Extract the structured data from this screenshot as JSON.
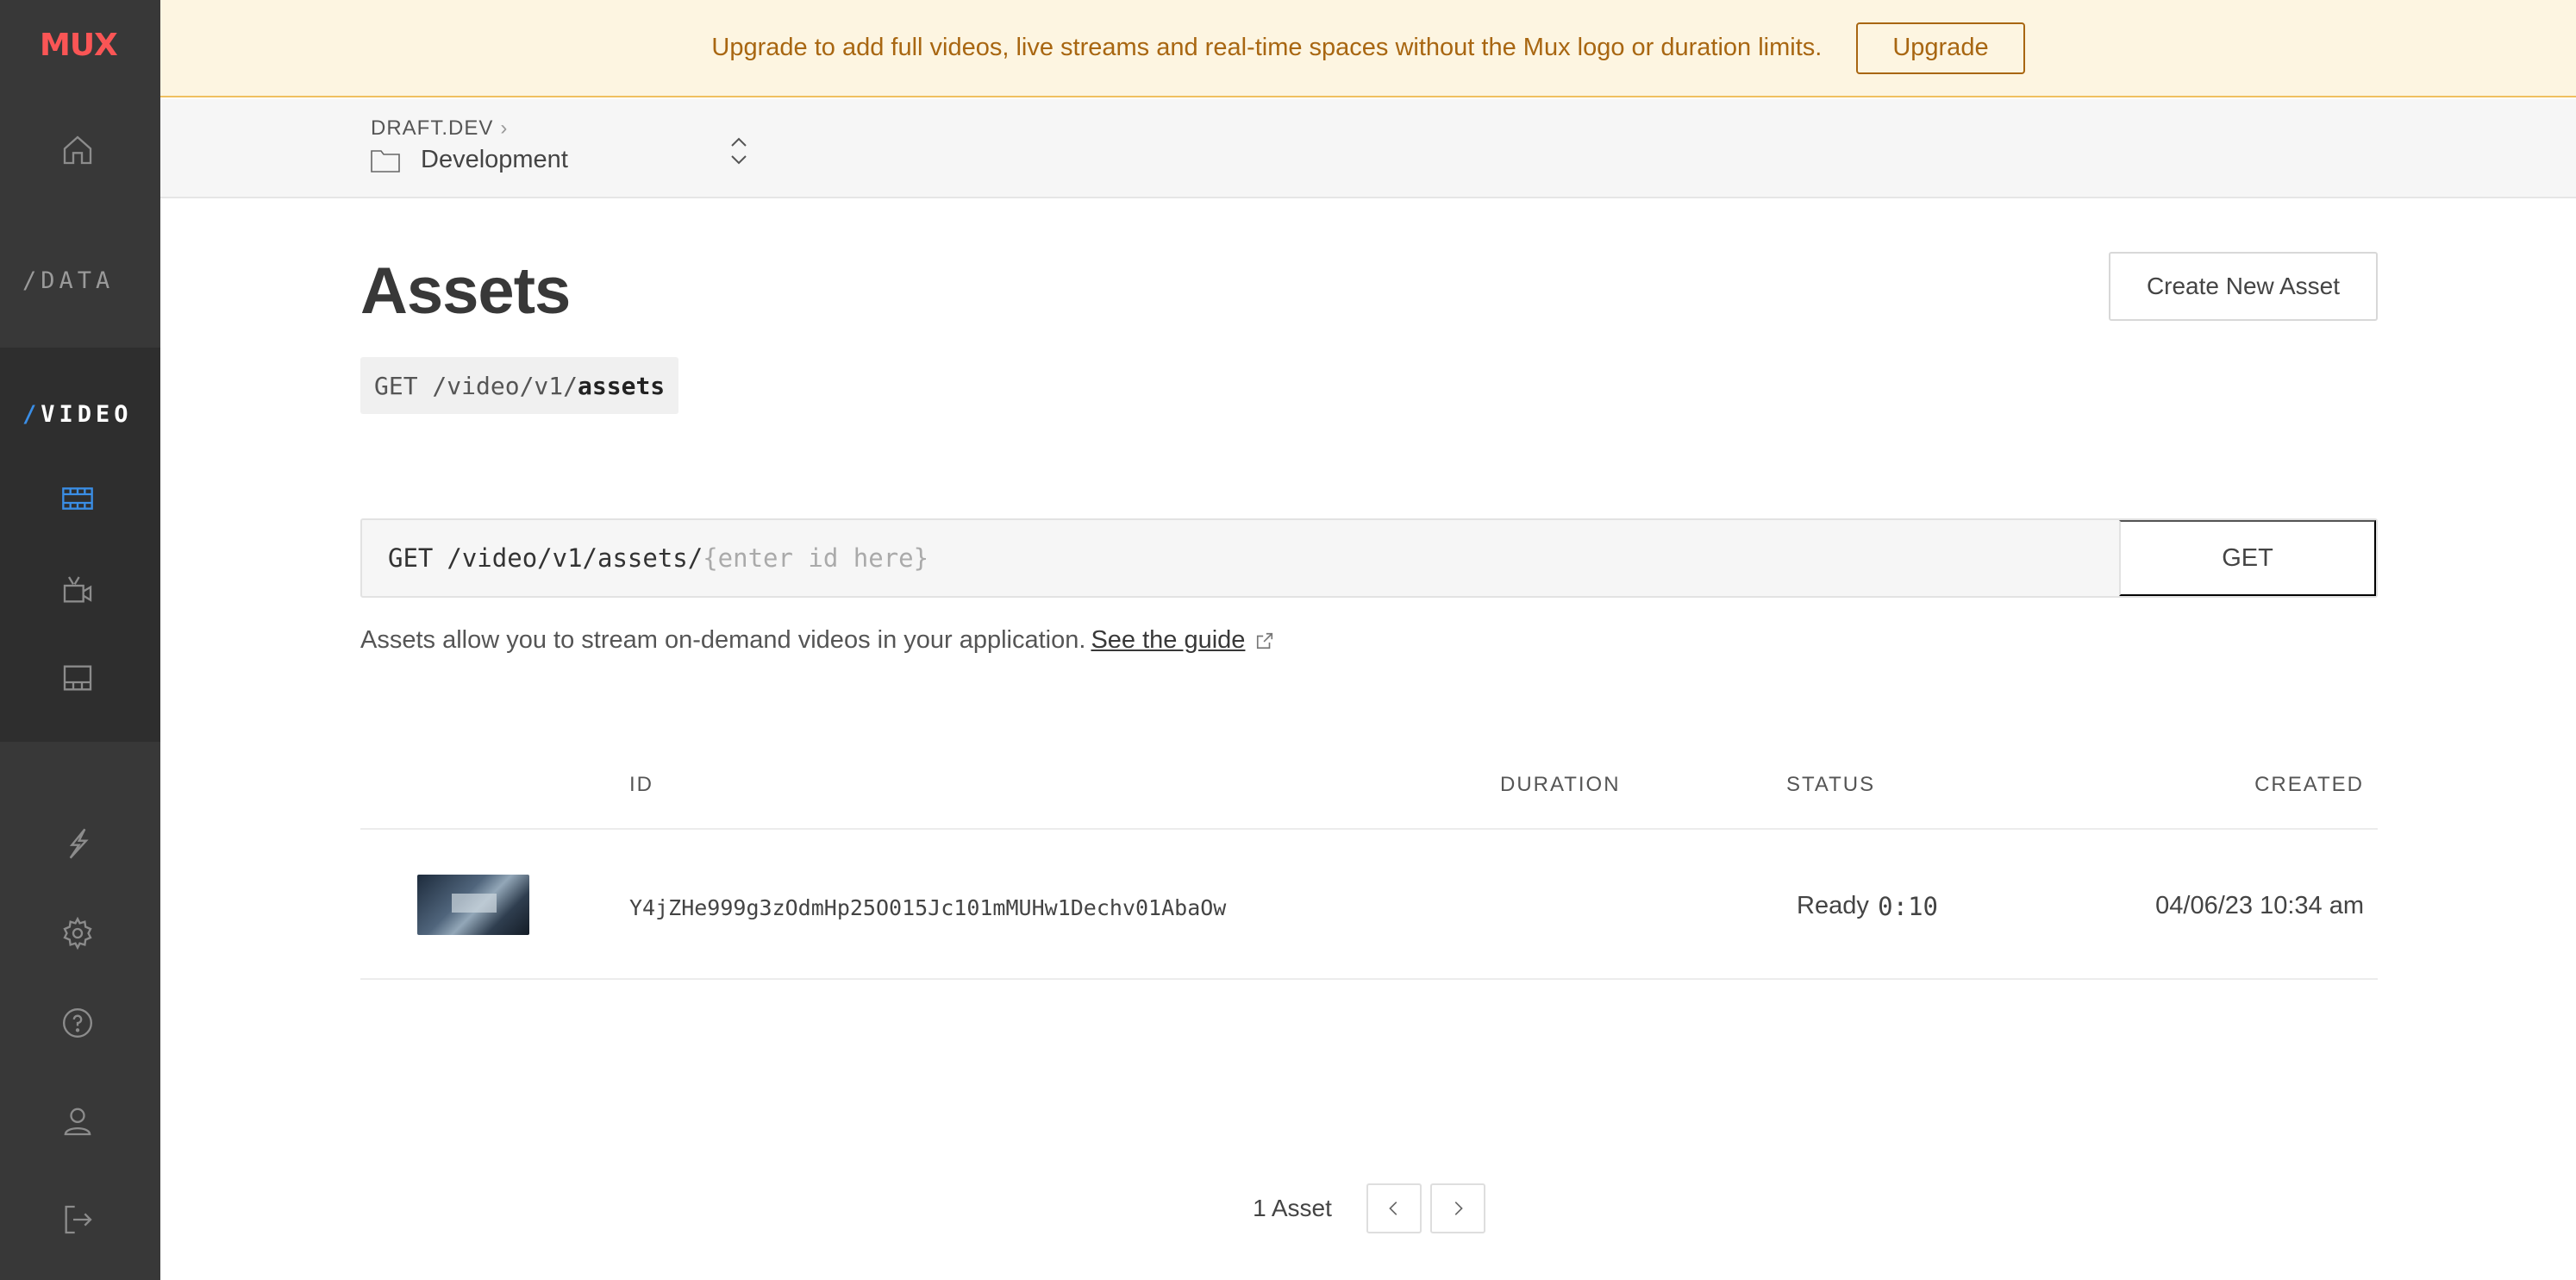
{
  "brand": {
    "logo_text": "MUX",
    "logo_color": "#fa5555"
  },
  "sidebar": {
    "sections": [
      {
        "label": "/DATA"
      },
      {
        "slash": "/",
        "label": "VIDEO"
      }
    ],
    "icons": [
      "home-icon",
      "film-icon",
      "live-camera-icon",
      "layout-icon",
      "lightning-icon",
      "gear-icon",
      "help-icon",
      "user-icon",
      "logout-icon"
    ],
    "accent": "#3a8ee6"
  },
  "banner": {
    "text": "Upgrade to add full videos, live streams and real-time spaces without the Mux logo or duration limits.",
    "button": "Upgrade"
  },
  "env": {
    "org": "DRAFT.DEV",
    "environment": "Development"
  },
  "page": {
    "title": "Assets",
    "create_button": "Create New Asset",
    "endpoint_prefix": "GET /video/v1/",
    "endpoint_resource": "assets",
    "get_method": "GET",
    "get_path": "/video/v1/assets/",
    "get_placeholder": "{enter id here}",
    "get_button": "GET",
    "description": "Assets allow you to stream on-demand videos in your application.",
    "guide_link": "See the guide"
  },
  "table": {
    "columns": {
      "id": "ID",
      "duration": "DURATION",
      "status": "STATUS",
      "created": "CREATED"
    },
    "rows": [
      {
        "id": "Y4jZHe999g3zOdmHp25O015Jc101mMUHw1Dechv01AbaOw",
        "duration": "0:10",
        "status": "Ready",
        "created": "04/06/23 10:34 am"
      }
    ]
  },
  "pagination": {
    "count_label": "1 Asset"
  }
}
